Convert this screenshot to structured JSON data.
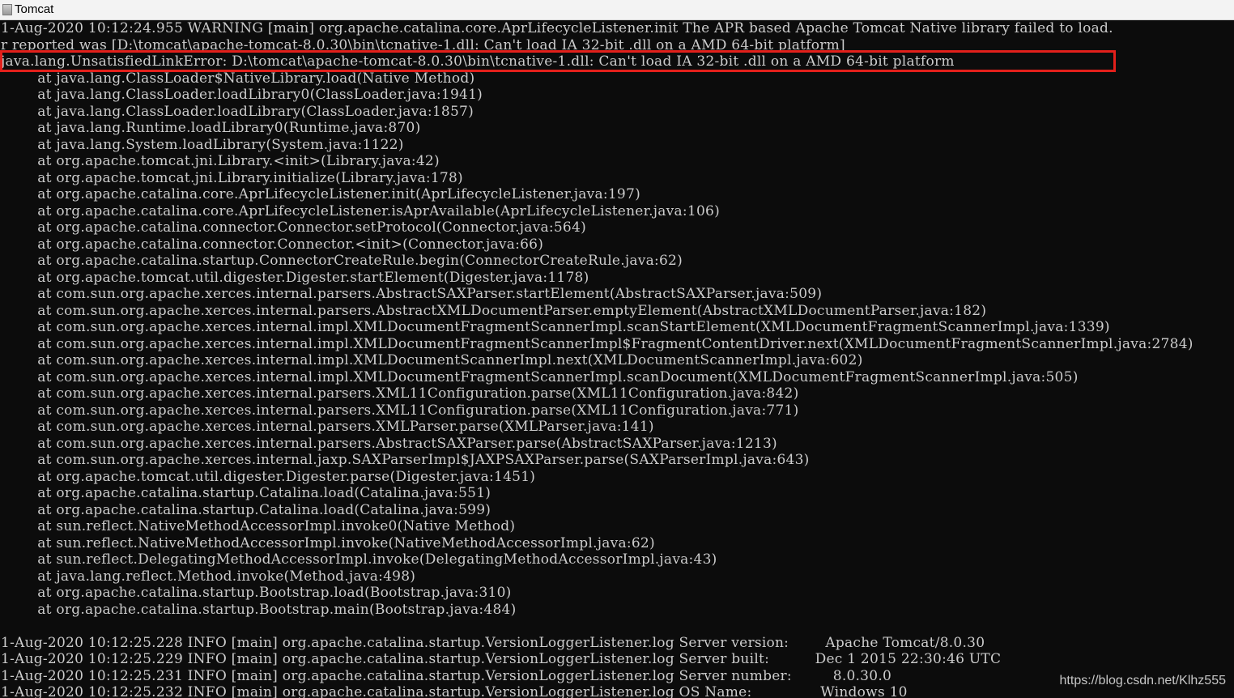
{
  "window": {
    "title": "Tomcat",
    "icon": "java-cup-icon"
  },
  "console": {
    "lines": [
      "1-Aug-2020 10:12:24.955 WARNING [main] org.apache.catalina.core.AprLifecycleListener.init The APR based Apache Tomcat Native library failed to load.",
      "r reported was [D:\\tomcat\\apache-tomcat-8.0.30\\bin\\tcnative-1.dll: Can't load IA 32-bit .dll on a AMD 64-bit platform]",
      "java.lang.UnsatisfiedLinkError: D:\\tomcat\\apache-tomcat-8.0.30\\bin\\tcnative-1.dll: Can't load IA 32-bit .dll on a AMD 64-bit platform",
      "        at java.lang.ClassLoader$NativeLibrary.load(Native Method)",
      "        at java.lang.ClassLoader.loadLibrary0(ClassLoader.java:1941)",
      "        at java.lang.ClassLoader.loadLibrary(ClassLoader.java:1857)",
      "        at java.lang.Runtime.loadLibrary0(Runtime.java:870)",
      "        at java.lang.System.loadLibrary(System.java:1122)",
      "        at org.apache.tomcat.jni.Library.<init>(Library.java:42)",
      "        at org.apache.tomcat.jni.Library.initialize(Library.java:178)",
      "        at org.apache.catalina.core.AprLifecycleListener.init(AprLifecycleListener.java:197)",
      "        at org.apache.catalina.core.AprLifecycleListener.isAprAvailable(AprLifecycleListener.java:106)",
      "        at org.apache.catalina.connector.Connector.setProtocol(Connector.java:564)",
      "        at org.apache.catalina.connector.Connector.<init>(Connector.java:66)",
      "        at org.apache.catalina.startup.ConnectorCreateRule.begin(ConnectorCreateRule.java:62)",
      "        at org.apache.tomcat.util.digester.Digester.startElement(Digester.java:1178)",
      "        at com.sun.org.apache.xerces.internal.parsers.AbstractSAXParser.startElement(AbstractSAXParser.java:509)",
      "        at com.sun.org.apache.xerces.internal.parsers.AbstractXMLDocumentParser.emptyElement(AbstractXMLDocumentParser.java:182)",
      "        at com.sun.org.apache.xerces.internal.impl.XMLDocumentFragmentScannerImpl.scanStartElement(XMLDocumentFragmentScannerImpl.java:1339)",
      "        at com.sun.org.apache.xerces.internal.impl.XMLDocumentFragmentScannerImpl$FragmentContentDriver.next(XMLDocumentFragmentScannerImpl.java:2784)",
      "        at com.sun.org.apache.xerces.internal.impl.XMLDocumentScannerImpl.next(XMLDocumentScannerImpl.java:602)",
      "        at com.sun.org.apache.xerces.internal.impl.XMLDocumentFragmentScannerImpl.scanDocument(XMLDocumentFragmentScannerImpl.java:505)",
      "        at com.sun.org.apache.xerces.internal.parsers.XML11Configuration.parse(XML11Configuration.java:842)",
      "        at com.sun.org.apache.xerces.internal.parsers.XML11Configuration.parse(XML11Configuration.java:771)",
      "        at com.sun.org.apache.xerces.internal.parsers.XMLParser.parse(XMLParser.java:141)",
      "        at com.sun.org.apache.xerces.internal.parsers.AbstractSAXParser.parse(AbstractSAXParser.java:1213)",
      "        at com.sun.org.apache.xerces.internal.jaxp.SAXParserImpl$JAXPSAXParser.parse(SAXParserImpl.java:643)",
      "        at org.apache.tomcat.util.digester.Digester.parse(Digester.java:1451)",
      "        at org.apache.catalina.startup.Catalina.load(Catalina.java:551)",
      "        at org.apache.catalina.startup.Catalina.load(Catalina.java:599)",
      "        at sun.reflect.NativeMethodAccessorImpl.invoke0(Native Method)",
      "        at sun.reflect.NativeMethodAccessorImpl.invoke(NativeMethodAccessorImpl.java:62)",
      "        at sun.reflect.DelegatingMethodAccessorImpl.invoke(DelegatingMethodAccessorImpl.java:43)",
      "        at java.lang.reflect.Method.invoke(Method.java:498)",
      "        at org.apache.catalina.startup.Bootstrap.load(Bootstrap.java:310)",
      "        at org.apache.catalina.startup.Bootstrap.main(Bootstrap.java:484)",
      "",
      "1-Aug-2020 10:12:25.228 INFO [main] org.apache.catalina.startup.VersionLoggerListener.log Server version:        Apache Tomcat/8.0.30",
      "1-Aug-2020 10:12:25.229 INFO [main] org.apache.catalina.startup.VersionLoggerListener.log Server built:          Dec 1 2015 22:30:46 UTC",
      "1-Aug-2020 10:12:25.231 INFO [main] org.apache.catalina.startup.VersionLoggerListener.log Server number:         8.0.30.0",
      "1-Aug-2020 10:12:25.232 INFO [main] org.apache.catalina.startup.VersionLoggerListener.log OS Name:               Windows 10"
    ]
  },
  "annotation": {
    "highlight_color": "#e3201b",
    "highlighted_line": 3
  },
  "watermark": "https://blog.csdn.net/Klhz555"
}
